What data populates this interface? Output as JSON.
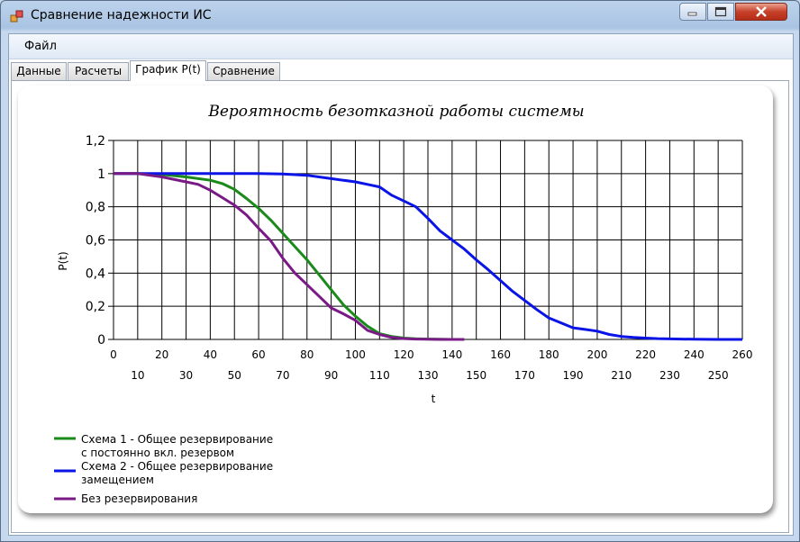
{
  "window": {
    "title": "Сравнение надежности ИС"
  },
  "menu": {
    "file": "Файл"
  },
  "tabs": [
    {
      "label": "Данные",
      "active": false
    },
    {
      "label": "Расчеты",
      "active": false
    },
    {
      "label": "График P(t)",
      "active": true
    },
    {
      "label": "Сравнение",
      "active": false
    }
  ],
  "colors": {
    "scheme1": "#1a8a1a",
    "scheme2": "#0a14e6",
    "none": "#7a1a87"
  },
  "chart_data": {
    "type": "line",
    "title": "Вероятность безотказной работы системы",
    "xlabel": "t",
    "ylabel": "P(t)",
    "xlim": [
      0,
      260
    ],
    "ylim": [
      0,
      1.2
    ],
    "xticks_top": [
      "0",
      "20",
      "40",
      "60",
      "80",
      "100",
      "120",
      "140",
      "160",
      "180",
      "200",
      "220",
      "240",
      "260"
    ],
    "xticks_bottom": [
      "10",
      "30",
      "50",
      "70",
      "90",
      "110",
      "130",
      "150",
      "170",
      "190",
      "210",
      "230",
      "250"
    ],
    "yticks": [
      "0",
      "0,2",
      "0,4",
      "0,6",
      "0,8",
      "1",
      "1,2"
    ],
    "grid": true,
    "legend_position": "bottom-left",
    "series": [
      {
        "name": "Схема 1 - Общее резервирование с постоянно вкл. резервом",
        "x": [
          0,
          10,
          20,
          30,
          40,
          45,
          50,
          55,
          60,
          65,
          70,
          75,
          80,
          85,
          90,
          95,
          100,
          105,
          110,
          115,
          120,
          125,
          130,
          135,
          140,
          145
        ],
        "y": [
          1.0,
          1.0,
          0.995,
          0.98,
          0.96,
          0.94,
          0.905,
          0.85,
          0.79,
          0.72,
          0.64,
          0.56,
          0.48,
          0.39,
          0.3,
          0.21,
          0.14,
          0.08,
          0.035,
          0.018,
          0.008,
          0.004,
          0.002,
          0.001,
          0.0,
          0.0
        ]
      },
      {
        "name": "Схема 2 - Общее резервирование замещением",
        "x": [
          0,
          10,
          20,
          30,
          40,
          50,
          60,
          70,
          80,
          90,
          100,
          105,
          110,
          115,
          120,
          125,
          130,
          135,
          140,
          145,
          150,
          155,
          160,
          165,
          170,
          175,
          180,
          185,
          190,
          195,
          200,
          205,
          210,
          215,
          220,
          225,
          230,
          240,
          250,
          260
        ],
        "y": [
          1.0,
          1.0,
          1.0,
          1.0,
          1.0,
          1.0,
          1.0,
          0.998,
          0.99,
          0.97,
          0.95,
          0.935,
          0.92,
          0.87,
          0.835,
          0.8,
          0.73,
          0.655,
          0.6,
          0.545,
          0.48,
          0.42,
          0.355,
          0.29,
          0.235,
          0.18,
          0.13,
          0.1,
          0.07,
          0.06,
          0.05,
          0.03,
          0.018,
          0.012,
          0.008,
          0.005,
          0.003,
          0.001,
          0.0,
          0.0
        ]
      },
      {
        "name": "Без резервирования",
        "x": [
          0,
          10,
          20,
          30,
          35,
          40,
          45,
          50,
          55,
          60,
          65,
          70,
          75,
          80,
          85,
          90,
          95,
          100,
          105,
          110,
          115,
          120,
          125,
          130,
          135,
          140,
          145
        ],
        "y": [
          1.0,
          1.0,
          0.98,
          0.95,
          0.935,
          0.9,
          0.855,
          0.81,
          0.75,
          0.67,
          0.595,
          0.49,
          0.4,
          0.33,
          0.26,
          0.19,
          0.155,
          0.115,
          0.055,
          0.03,
          0.012,
          0.005,
          0.002,
          0.001,
          0.0,
          0.0,
          0.0
        ]
      }
    ]
  }
}
